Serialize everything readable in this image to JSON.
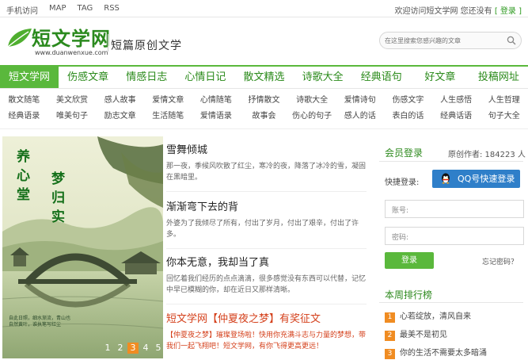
{
  "topbar": {
    "links": [
      "手机访问",
      "MAP",
      "TAG",
      "RSS"
    ],
    "welcome": "欢迎访问短文学网 您还没有",
    "login_link": "[ 登录 ]"
  },
  "header": {
    "logo_text": "短文学网",
    "logo_url": "www.duanwenxue.com",
    "slogan": "短篇原创文学",
    "search_placeholder": "在这里搜索您感兴趣的文章"
  },
  "nav": {
    "items": [
      "短文学网",
      "伤感文章",
      "情感日志",
      "心情日记",
      "散文精选",
      "诗歌大全",
      "经典语句",
      "好文章",
      "投稿网址"
    ]
  },
  "subnav": {
    "row1": [
      "散文随笔",
      "美文欣赏",
      "感人故事",
      "爱情文章",
      "心情随笔",
      "抒情散文",
      "诗歌大全",
      "爱情诗句",
      "伤感文字",
      "人生感悟",
      "人生哲理"
    ],
    "row2": [
      "经典语录",
      "唯美句子",
      "励志文章",
      "生活随笔",
      "爱情语录",
      "故事会",
      "伤心的句子",
      "感人的话",
      "表白的话",
      "经典话语",
      "句子大全"
    ]
  },
  "slideshow": {
    "calligraphy_left": "养心堂",
    "calligraphy_right": "梦归实",
    "small_caption": "自此日照，细水渐流，青山也自然黄叶，谁执笔写红尘",
    "pages": [
      "1",
      "2",
      "3",
      "4",
      "5"
    ],
    "active_page": 3
  },
  "articles": [
    {
      "title": "雪舞倾城",
      "desc": "那一夜，季候风吹散了红尘，寒冷的夜，降落了冰冷的雪，凝固在黑暗里。"
    },
    {
      "title": "渐渐弯下去的背",
      "desc": "外婆为了我倾尽了所有，付出了岁月，付出了艰辛，付出了许多。"
    },
    {
      "title": "你本无意，我却当了真",
      "desc": "回忆着我们经历的点点滴滴，很多感觉没有东西可以代替，记忆中早已模糊的你，却在近日又那样清晰。"
    },
    {
      "title": "短文学网【仲夏夜之梦】有奖征文",
      "desc": "【仲夏夜之梦】璀璨登场啦！快用你充满斗志与力量的梦想，带我们一起飞翔吧！短文学网，有你飞得更高更远！"
    }
  ],
  "member": {
    "title": "会员登录",
    "count_text": "原创作者: 184223 人",
    "quick_label": "快捷登录:",
    "qq_button": "QQ号快速登录",
    "account_placeholder": "账号:",
    "password_placeholder": "密码:",
    "login_button": "登录",
    "forgot": "忘记密码？"
  },
  "ranking": {
    "title": "本周排行榜",
    "items": [
      {
        "num": "1",
        "text": "心若绽放，清风自来"
      },
      {
        "num": "2",
        "text": "最美不是初见"
      },
      {
        "num": "3",
        "text": "你的生活不需要太多暗涌"
      }
    ]
  },
  "colors": {
    "brand_green": "#5ab83c",
    "link_green": "#2e8a1e",
    "highlight_red": "#d43f1a",
    "qq_blue": "#2f7fc9",
    "rank_orange": "#f08c22"
  }
}
